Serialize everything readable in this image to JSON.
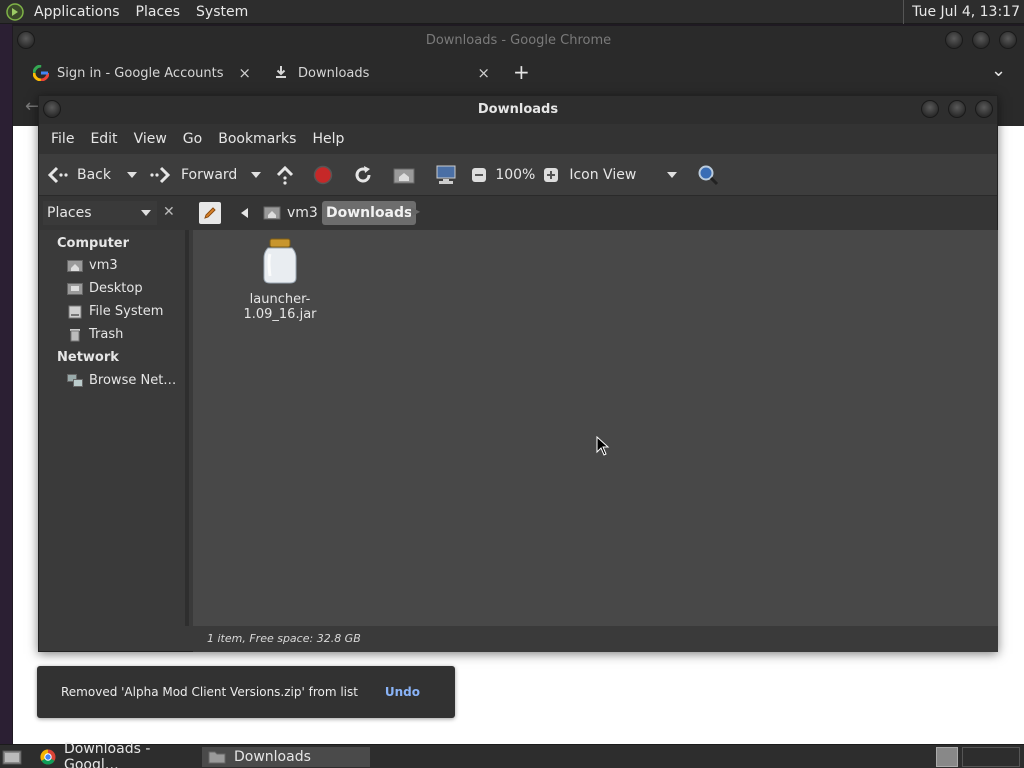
{
  "top_panel": {
    "menus": [
      "Applications",
      "Places",
      "System"
    ],
    "clock": "Tue Jul  4, 13:17"
  },
  "chrome": {
    "window_title": "Downloads - Google Chrome",
    "tabs": [
      {
        "label": "Sign in - Google Accounts"
      },
      {
        "label": "Downloads"
      }
    ],
    "new_tab": "+",
    "close_glyph": "×",
    "tab_menu_glyph": "⌄"
  },
  "file_manager": {
    "title": "Downloads",
    "menubar": [
      "File",
      "Edit",
      "View",
      "Go",
      "Bookmarks",
      "Help"
    ],
    "toolbar": {
      "back": "Back",
      "forward": "Forward",
      "zoom": "100%",
      "view_mode": "Icon View"
    },
    "location": {
      "pane_selector": "Places",
      "close_glyph": "✕",
      "crumbs": [
        "vm3",
        "Downloads"
      ]
    },
    "sidebar": {
      "sections": [
        {
          "heading": "Computer",
          "items": [
            "vm3",
            "Desktop",
            "File System",
            "Trash"
          ]
        },
        {
          "heading": "Network",
          "items": [
            "Browse Net…"
          ]
        }
      ]
    },
    "files": [
      {
        "name": "launcher-1.09_16.jar",
        "icon": "jar-icon"
      }
    ],
    "status": "1 item, Free space: 32.8 GB"
  },
  "toast": {
    "message": "Removed 'Alpha Mod Client Versions.zip' from list",
    "action": "Undo"
  },
  "taskbar": {
    "items": [
      "Downloads - Googl…",
      "Downloads"
    ]
  },
  "colors": {
    "panel": "#2d2d2d",
    "window": "#3a3a3a",
    "content": "#484848",
    "accent_link": "#8ab4f8",
    "stop_red": "#c62828"
  }
}
